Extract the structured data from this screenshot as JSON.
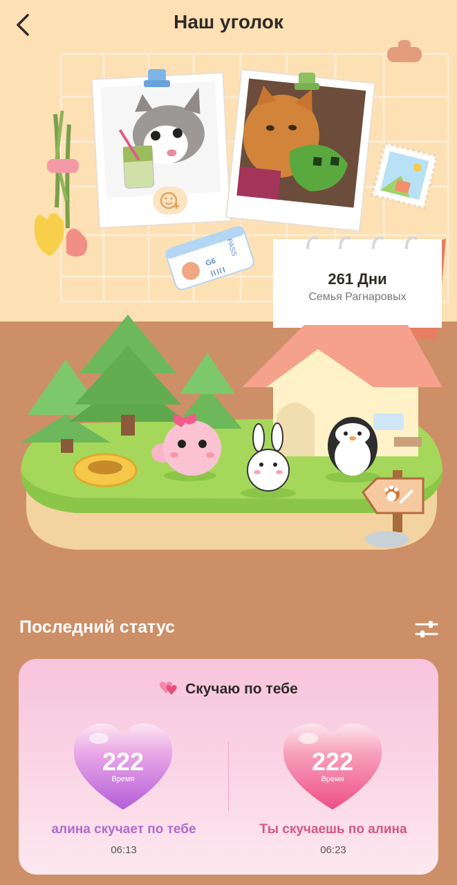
{
  "header": {
    "title": "Наш уголок"
  },
  "anniversary": {
    "days": "261 Дни",
    "family": "Семья Рагнаровых"
  },
  "status_section": {
    "title": "Последний статус"
  },
  "miss_card": {
    "title": "Скучаю по тебе",
    "left": {
      "count": "222",
      "unit": "Время",
      "label": "алина скучает по тебе",
      "time": "06:13"
    },
    "right": {
      "count": "222",
      "unit": "Время",
      "label": "Ты скучаешь по алина",
      "time": "06:23"
    }
  },
  "colors": {
    "wall": "#fde0b4",
    "floor": "#cd8f67",
    "grass": "#a5d85a",
    "left_label": "#b06ad1",
    "right_label": "#d6577f"
  },
  "ticket": {
    "text": "PASS",
    "seat": "G6"
  }
}
